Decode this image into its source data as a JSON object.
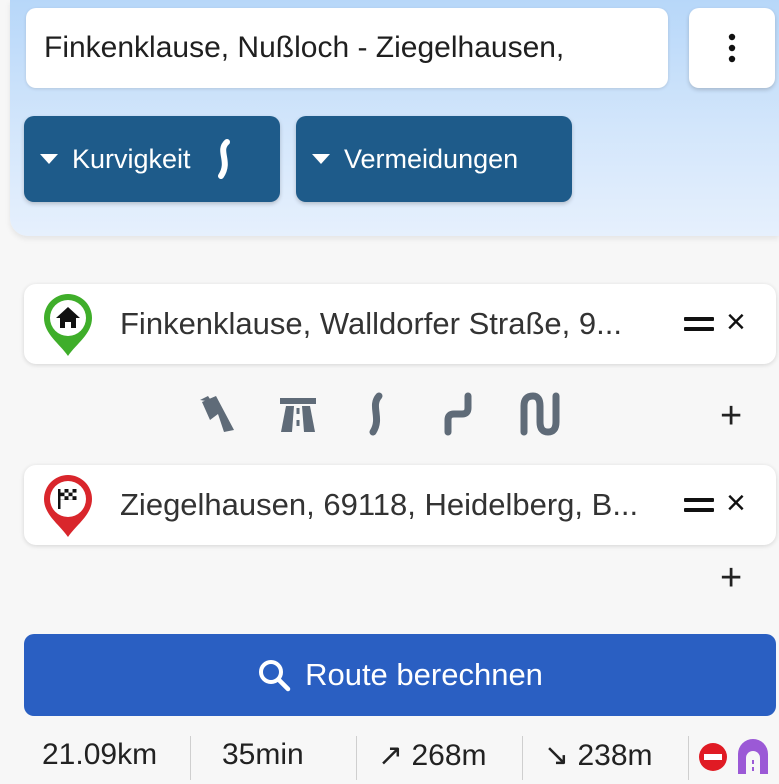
{
  "search": {
    "value": "Finkenklause, Nußloch - Ziegelhausen,"
  },
  "menu": {
    "icon": "more-vert-icon"
  },
  "filters": {
    "curvy_label": "Kurvigkeit",
    "avoid_label": "Vermeidungen"
  },
  "waypoints": {
    "start": {
      "label": "Finkenklause, Walldorfer Straße, 9...",
      "icon": "home-pin-icon",
      "color": "#3fae2a"
    },
    "destination": {
      "label": "Ziegelhausen, 69118, Heidelberg, B...",
      "icon": "finish-flag-pin-icon",
      "color": "#d9262c"
    }
  },
  "road_types": [
    "fastest-route-icon",
    "motorway-icon",
    "slight-curve-icon",
    "curvy-icon",
    "very-curvy-icon"
  ],
  "add_symbol": "+",
  "remove_symbol": "×",
  "calculate": {
    "label": "Route berechnen"
  },
  "stats": {
    "distance": "21.09km",
    "duration": "35min",
    "ascent": "↗ 268m",
    "descent": "↘ 238m"
  },
  "colors": {
    "primary": "#2a5fc2",
    "filter_pill": "#1e5b8a",
    "icon_gray": "#5f6b78"
  }
}
